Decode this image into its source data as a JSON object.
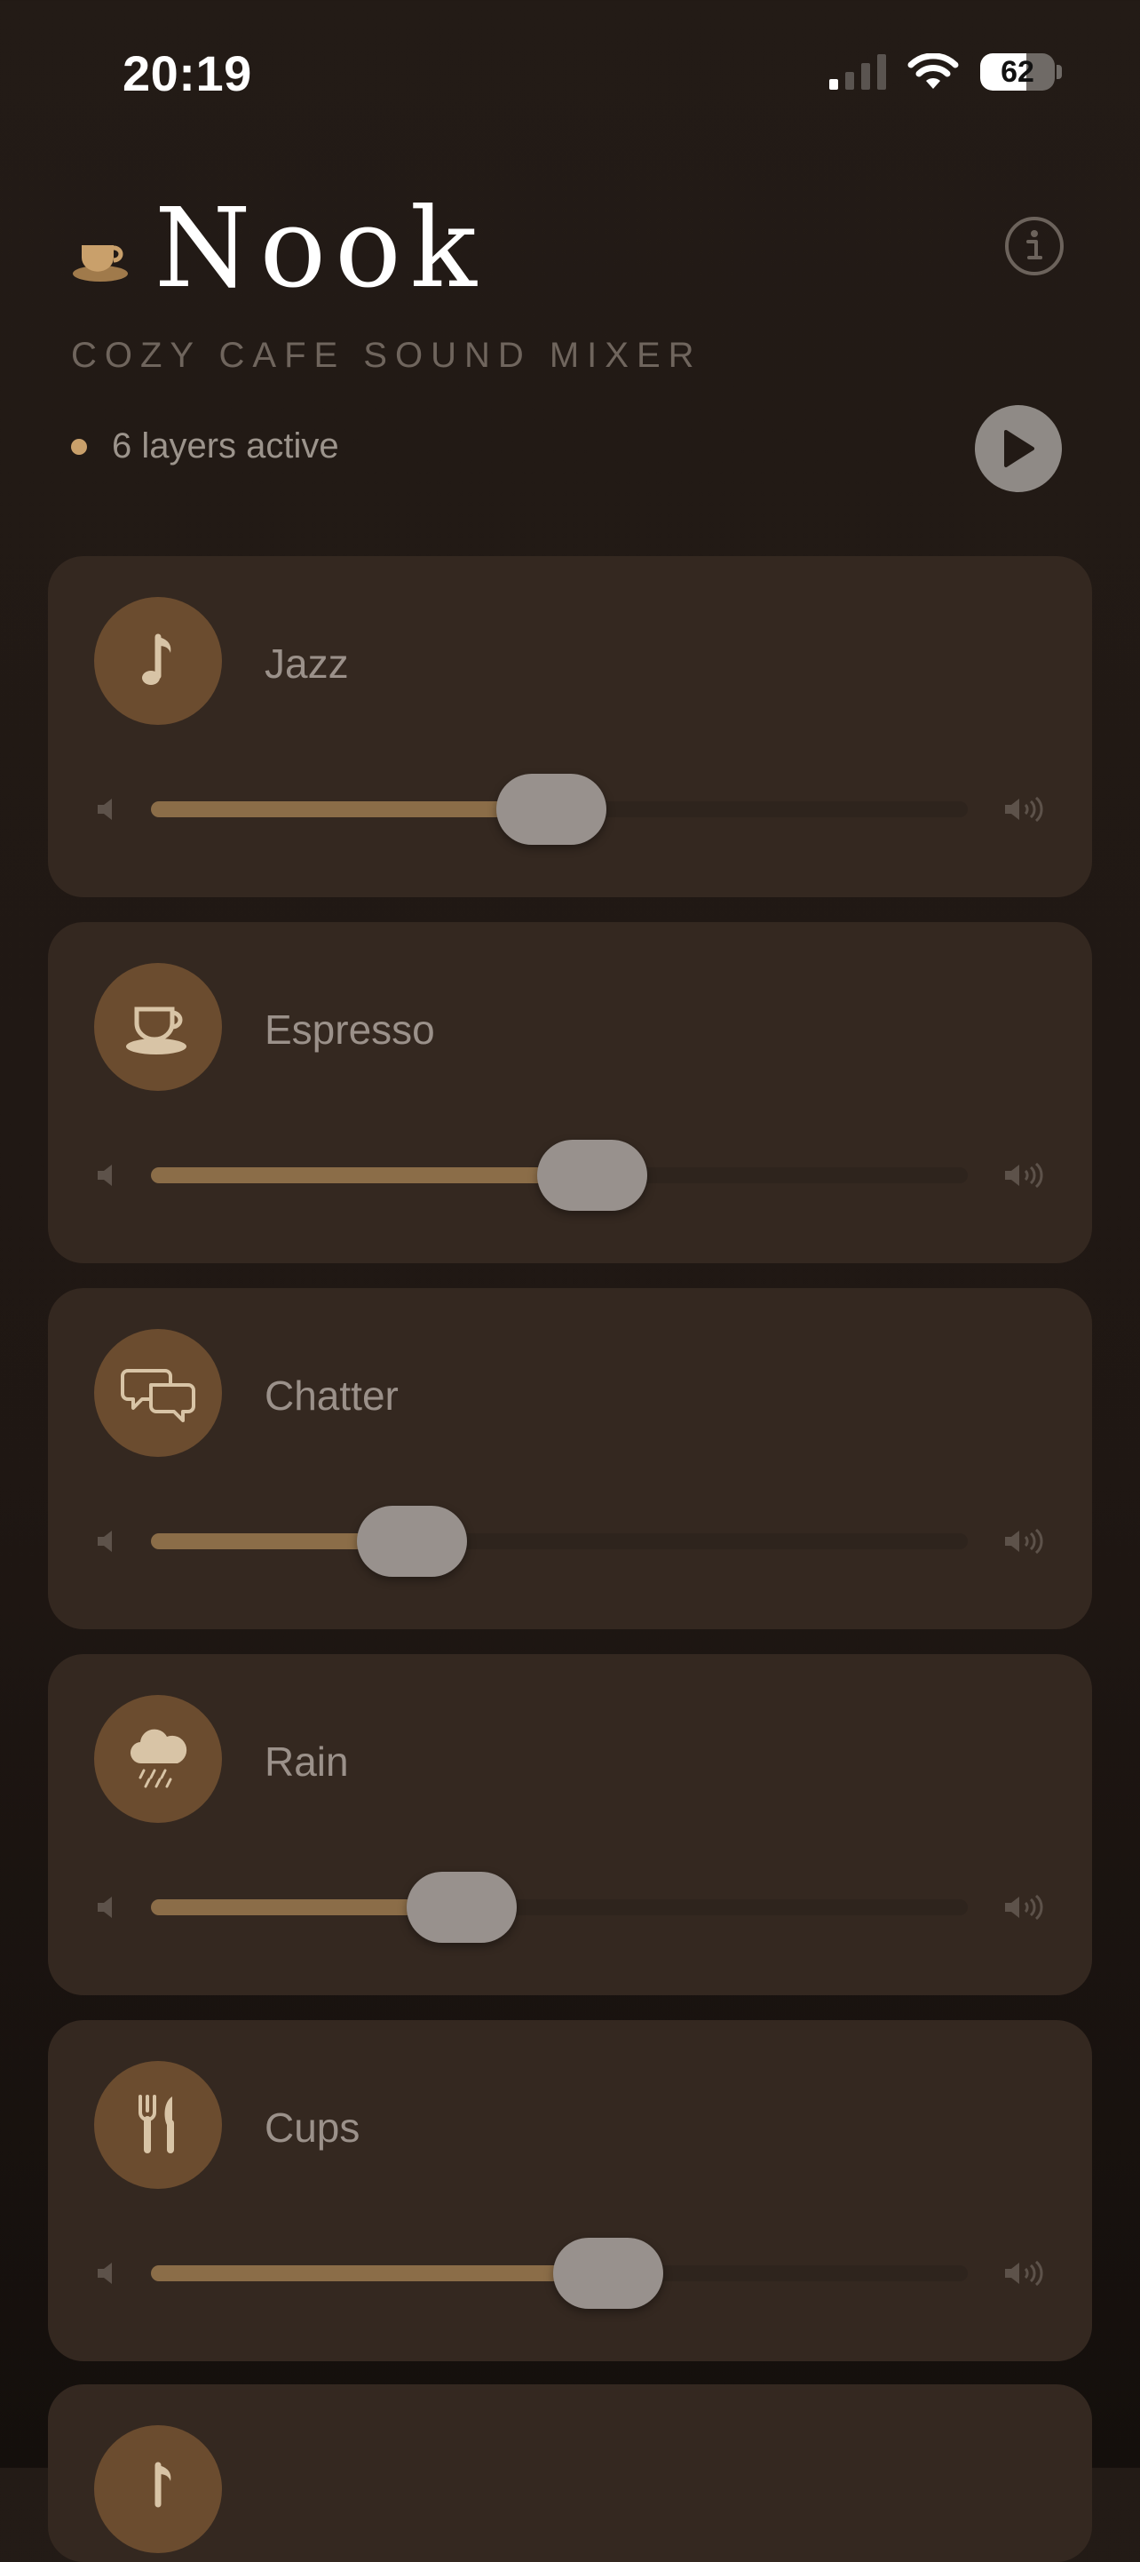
{
  "status_bar": {
    "time": "20:19",
    "battery": 62
  },
  "header": {
    "title": "Nook",
    "subtitle": "COZY CAFE SOUND MIXER",
    "active_label": "6 layers active",
    "colors": {
      "accent": "#c9a06b",
      "icon_bg": "#6b4c2f",
      "card_bg": "#342820"
    }
  },
  "sounds": [
    {
      "name": "Jazz",
      "icon": "music-note-icon",
      "volume": 0.49
    },
    {
      "name": "Espresso",
      "icon": "coffee-cup-icon",
      "volume": 0.54
    },
    {
      "name": "Chatter",
      "icon": "chat-bubbles-icon",
      "volume": 0.32
    },
    {
      "name": "Rain",
      "icon": "rain-cloud-icon",
      "volume": 0.38
    },
    {
      "name": "Cups",
      "icon": "fork-knife-icon",
      "volume": 0.56
    }
  ]
}
